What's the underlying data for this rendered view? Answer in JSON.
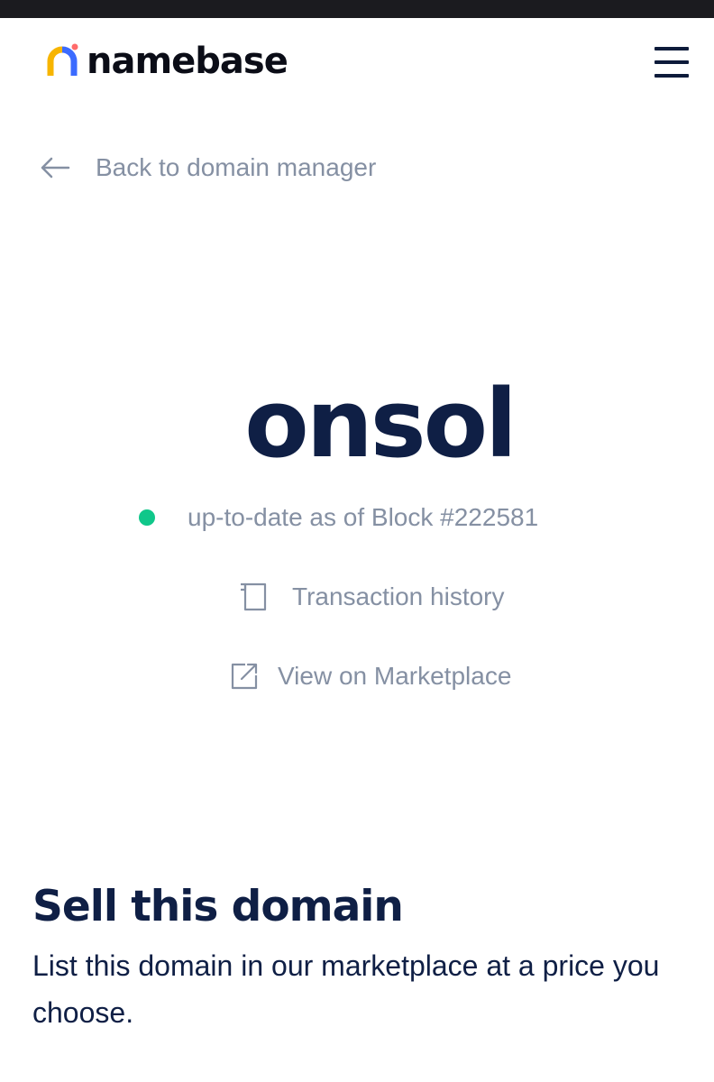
{
  "header": {
    "logo_text": "namebase",
    "icons": {
      "logo": "namebase-logo-icon",
      "menu": "hamburger-menu-icon"
    },
    "colors": {
      "logo_yellow": "#f7b500",
      "logo_blue": "#3b6bff",
      "logo_dot": "#ff6b6b"
    }
  },
  "nav": {
    "back_label": "Back to domain manager",
    "back_icon": "arrow-left-icon"
  },
  "domain": {
    "name": "onsol",
    "status_text": "up-to-date as of Block #222581",
    "status_color": "#10c78a",
    "links": {
      "transaction_history": "Transaction history",
      "transaction_history_icon": "document-icon",
      "view_marketplace": "View on Marketplace",
      "view_marketplace_icon": "external-link-icon"
    }
  },
  "sell": {
    "title": "Sell this domain",
    "description": "List this domain in our marketplace at a price you choose."
  }
}
